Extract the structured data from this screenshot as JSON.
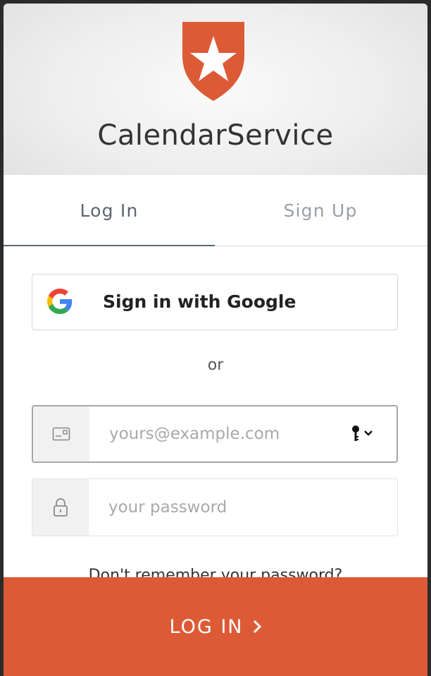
{
  "header": {
    "app_name": "CalendarService",
    "logo_icon": "auth0-shield-star-icon",
    "brand_color": "#dc5b36"
  },
  "tabs": [
    {
      "label": "Log In",
      "active": true
    },
    {
      "label": "Sign Up",
      "active": false
    }
  ],
  "social": {
    "google_label": "Sign in with Google",
    "google_icon": "google-g-icon"
  },
  "separator": "or",
  "email_field": {
    "placeholder": "yours@example.com",
    "value": "",
    "icon": "envelope-icon",
    "password_manager_icon": "key-chevron-icon"
  },
  "password_field": {
    "placeholder": "your password",
    "value": "",
    "icon": "lock-icon"
  },
  "forgot_password": "Don't remember your password?",
  "submit": {
    "label": "LOG IN",
    "icon": "chevron-right-icon"
  }
}
